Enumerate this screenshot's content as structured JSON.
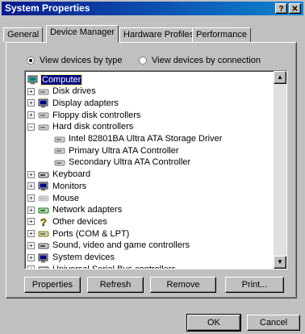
{
  "window": {
    "title": "System Properties",
    "help_label": "?",
    "close_label": "✕"
  },
  "tabs": [
    "General",
    "Device Manager",
    "Hardware Profiles",
    "Performance"
  ],
  "view": {
    "by_type": "View devices by type",
    "by_connection": "View devices by connection",
    "selected": "by_type"
  },
  "tree": [
    {
      "label": "Computer",
      "level": 0,
      "expander": "",
      "icon": "computer-icon",
      "selected": true
    },
    {
      "label": "Disk drives",
      "level": 1,
      "expander": "+",
      "icon": "disk-drive-icon"
    },
    {
      "label": "Display adapters",
      "level": 1,
      "expander": "+",
      "icon": "display-adapter-icon"
    },
    {
      "label": "Floppy disk controllers",
      "level": 1,
      "expander": "+",
      "icon": "floppy-controller-icon"
    },
    {
      "label": "Hard disk controllers",
      "level": 1,
      "expander": "−",
      "icon": "hard-disk-controller-icon"
    },
    {
      "label": "Intel 82801BA Ultra ATA Storage Driver",
      "level": 2,
      "expander": "",
      "icon": "controller-device-icon"
    },
    {
      "label": "Primary Ultra ATA Controller",
      "level": 2,
      "expander": "",
      "icon": "controller-device-icon"
    },
    {
      "label": "Secondary Ultra ATA Controller",
      "level": 2,
      "expander": "",
      "icon": "controller-device-icon"
    },
    {
      "label": "Keyboard",
      "level": 1,
      "expander": "+",
      "icon": "keyboard-icon"
    },
    {
      "label": "Monitors",
      "level": 1,
      "expander": "+",
      "icon": "monitor-icon"
    },
    {
      "label": "Mouse",
      "level": 1,
      "expander": "+",
      "icon": "mouse-icon"
    },
    {
      "label": "Network adapters",
      "level": 1,
      "expander": "+",
      "icon": "network-adapter-icon"
    },
    {
      "label": "Other devices",
      "level": 1,
      "expander": "+",
      "icon": "question-mark-icon"
    },
    {
      "label": "Ports (COM & LPT)",
      "level": 1,
      "expander": "+",
      "icon": "port-icon"
    },
    {
      "label": "Sound, video and game controllers",
      "level": 1,
      "expander": "+",
      "icon": "sound-icon"
    },
    {
      "label": "System devices",
      "level": 1,
      "expander": "+",
      "icon": "system-device-icon"
    },
    {
      "label": "Universal Serial Bus controllers",
      "level": 1,
      "expander": "+",
      "icon": "usb-icon"
    }
  ],
  "buttons": {
    "properties": "Properties",
    "refresh": "Refresh",
    "remove": "Remove",
    "print": "Print..."
  },
  "dialog": {
    "ok": "OK",
    "cancel": "Cancel"
  },
  "colors": {
    "title_start": "#0a1a8c",
    "title_end": "#1084d0",
    "face": "#c0c0c0",
    "selection": "#000080"
  }
}
